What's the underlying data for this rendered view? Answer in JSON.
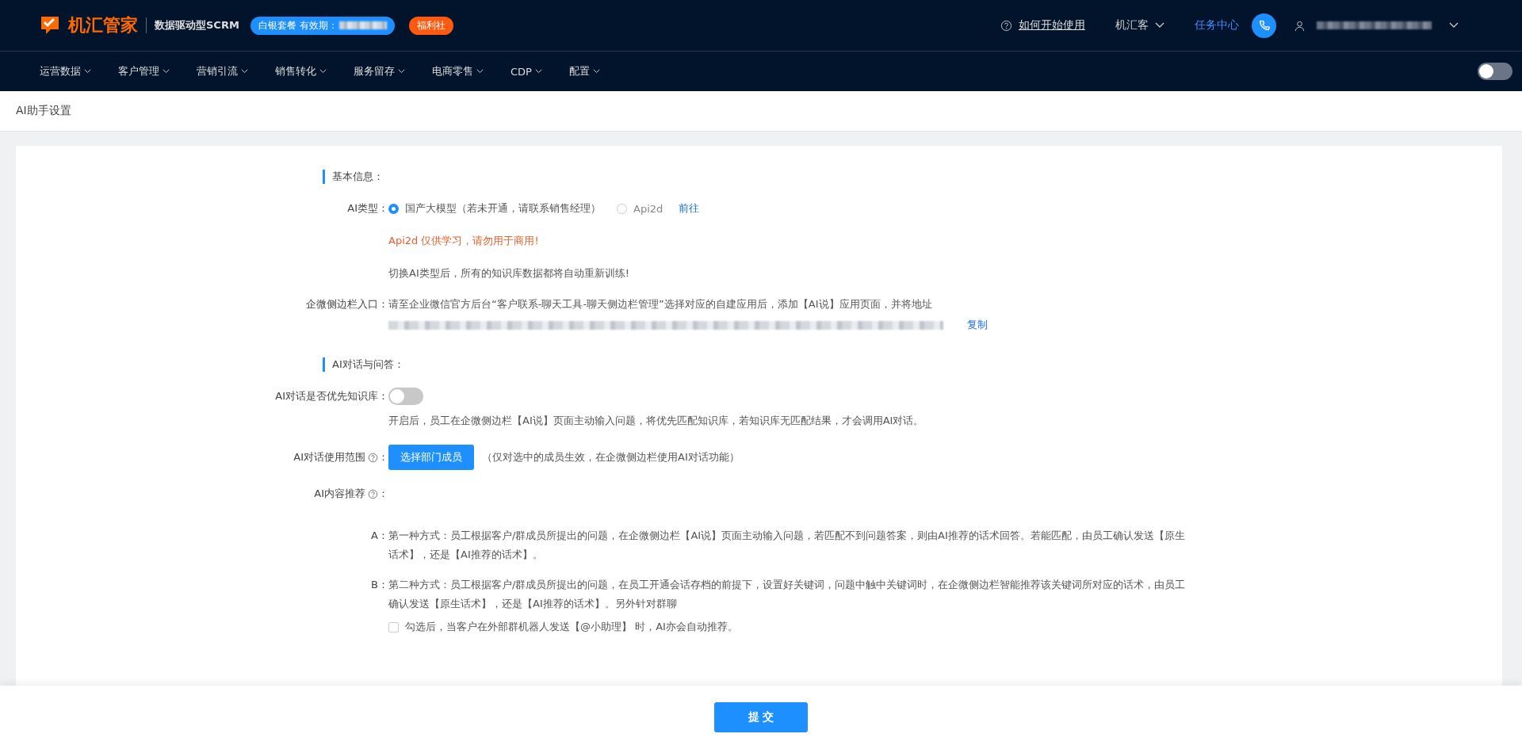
{
  "header": {
    "logo": "机汇管家",
    "tagline": "数据驱动型SCRM",
    "plan_badge": "白银套餐 有效期：",
    "welfare_badge": "福利社",
    "help_link": "如何开始使用",
    "org_menu": "机汇客",
    "task_center": "任务中心"
  },
  "nav": {
    "items": [
      "运营数据",
      "客户管理",
      "营销引流",
      "销售转化",
      "服务留存",
      "电商零售",
      "CDP",
      "配置"
    ],
    "theme_toggle": {
      "on": false
    }
  },
  "breadcrumb": "AI助手设置",
  "basic": {
    "title": "基本信息：",
    "ai_type_label": "AI类型：",
    "options": [
      {
        "label": "国产大模型（若未开通，请联系销售经理）",
        "selected": true
      },
      {
        "label": "Api2d",
        "selected": false
      }
    ],
    "goto_link": "前往",
    "warning": "Api2d 仅供学习，请勿用于商用!",
    "note": "切换AI类型后，所有的知识库数据都将自动重新训练!",
    "sidebar_label": "企微侧边栏入口：",
    "sidebar_text": "请至企业微信官方后台“客户联系-聊天工具-聊天侧边栏管理”选择对应的自建应用后，添加【AI说】应用页面，并将地址",
    "copy_link": "复制"
  },
  "dialog": {
    "title": "AI对话与问答：",
    "priority_label": "AI对话是否优先知识库：",
    "priority_toggle": {
      "on": false
    },
    "priority_desc": "开启后，员工在企微侧边栏【AI说】页面主动输入问题，将优先匹配知识库，若知识库无匹配结果，才会调用AI对话。",
    "scope_label": "AI对话使用范围",
    "scope_button": "选择部门成员",
    "scope_hint": "（仅对选中的成员生效，在企微侧边栏使用AI对话功能）",
    "scope_colon": "：",
    "recommend_label": "AI内容推荐",
    "recommend_colon": "：",
    "methods": [
      {
        "letter": "A：",
        "text": "第一种方式：员工根据客户/群成员所提出的问题，在企微侧边栏【AI说】页面主动输入问题，若匹配不到问题答案，则由AI推荐的话术回答。若能匹配，由员工确认发送【原生话术】，还是【AI推荐的话术】。"
      },
      {
        "letter": "B：",
        "text": "第二种方式：员工根据客户/群成员所提出的问题，在员工开通会话存档的前提下，设置好关键词，问题中触中关键词时，在企微侧边栏智能推荐该关键词所对应的话术，由员工确认发送【原生话术】，还是【AI推荐的话术】。另外针对群聊"
      }
    ],
    "group_option": {
      "label": "勾选后，当客户在外部群机器人发送【@小助理】 时，AI亦会自动推荐。",
      "checked": false
    }
  },
  "submit": "提 交"
}
